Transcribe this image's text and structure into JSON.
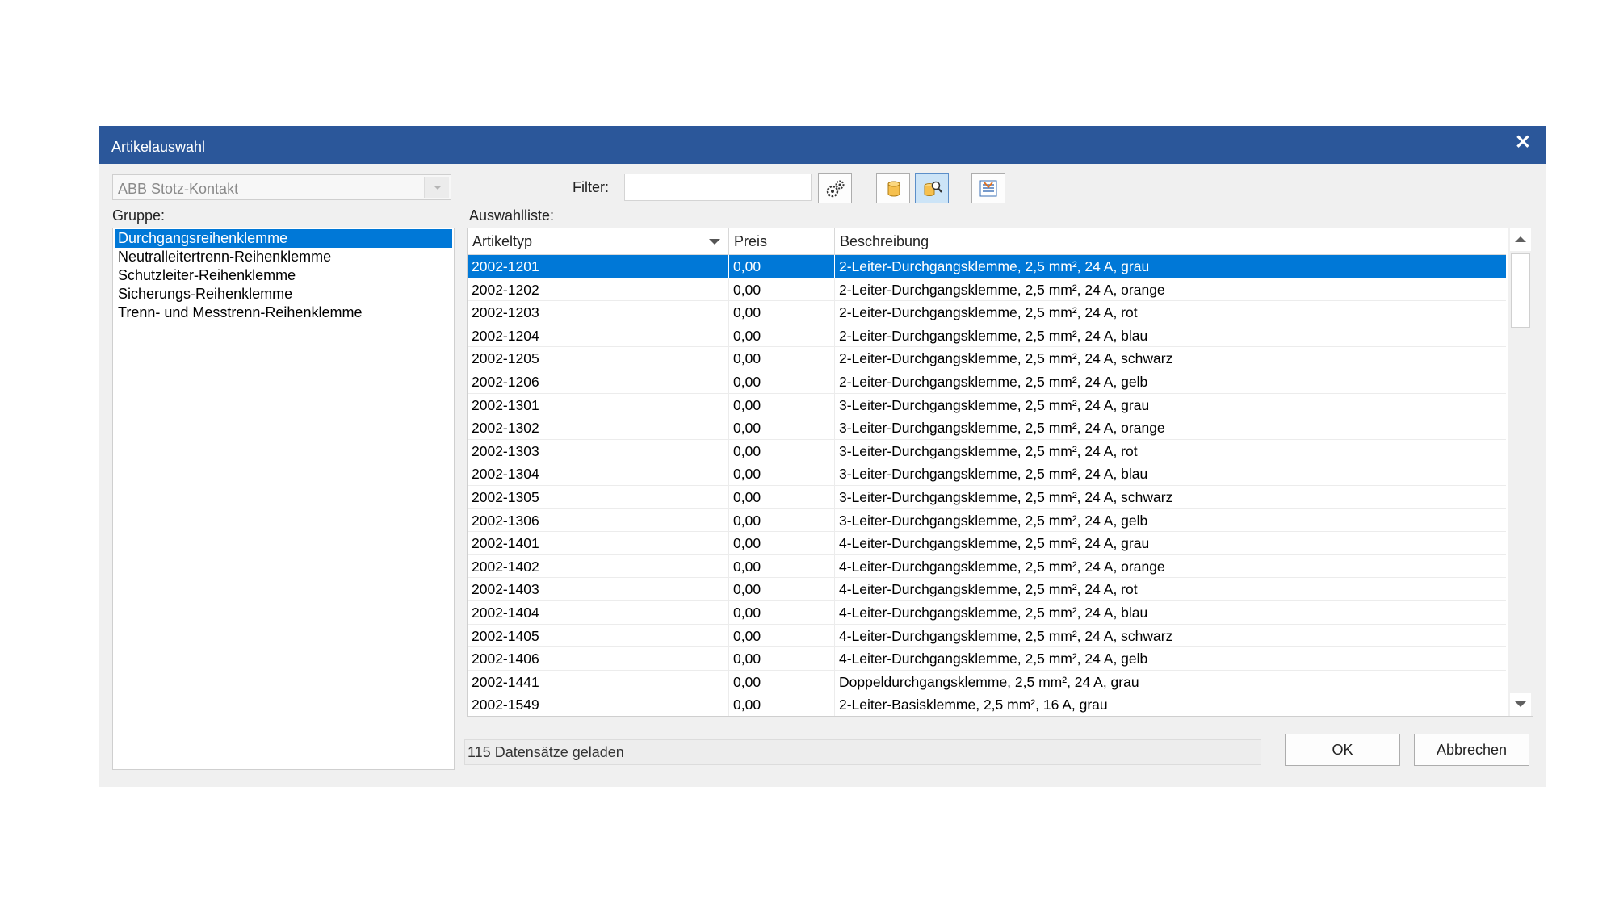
{
  "dialog": {
    "title": "Artikelauswahl"
  },
  "manufacturer": {
    "selected": "ABB Stotz-Kontakt"
  },
  "labels": {
    "group": "Gruppe:",
    "filter": "Filter:",
    "list": "Auswahlliste:"
  },
  "groups": [
    "Durchgangsreihenklemme",
    "Neutralleitertrenn-Reihenklemme",
    "Schutzleiter-Reihenklemme",
    "Sicherungs-Reihenklemme",
    "Trenn- und Messtrenn-Reihenklemme"
  ],
  "selected_group_index": 0,
  "filter": {
    "value": "",
    "placeholder": ""
  },
  "toolbar": {
    "filter_settings_icon": "gears-icon",
    "database_icon": "database-icon",
    "database_search_icon": "database-search-icon",
    "export_icon": "list-export-icon"
  },
  "table": {
    "columns": [
      "Artikeltyp",
      "Preis",
      "Beschreibung"
    ],
    "selected_row_index": 0,
    "rows": [
      [
        "2002-1201",
        "0,00",
        "2-Leiter-Durchgangsklemme, 2,5 mm², 24 A, grau"
      ],
      [
        "2002-1202",
        "0,00",
        "2-Leiter-Durchgangsklemme, 2,5 mm², 24 A, orange"
      ],
      [
        "2002-1203",
        "0,00",
        "2-Leiter-Durchgangsklemme, 2,5 mm², 24 A, rot"
      ],
      [
        "2002-1204",
        "0,00",
        "2-Leiter-Durchgangsklemme, 2,5 mm², 24 A, blau"
      ],
      [
        "2002-1205",
        "0,00",
        "2-Leiter-Durchgangsklemme, 2,5 mm², 24 A, schwarz"
      ],
      [
        "2002-1206",
        "0,00",
        "2-Leiter-Durchgangsklemme, 2,5 mm², 24 A, gelb"
      ],
      [
        "2002-1301",
        "0,00",
        "3-Leiter-Durchgangsklemme, 2,5 mm², 24 A, grau"
      ],
      [
        "2002-1302",
        "0,00",
        "3-Leiter-Durchgangsklemme, 2,5 mm², 24 A, orange"
      ],
      [
        "2002-1303",
        "0,00",
        "3-Leiter-Durchgangsklemme, 2,5 mm², 24 A, rot"
      ],
      [
        "2002-1304",
        "0,00",
        "3-Leiter-Durchgangsklemme, 2,5 mm², 24 A, blau"
      ],
      [
        "2002-1305",
        "0,00",
        "3-Leiter-Durchgangsklemme, 2,5 mm², 24 A, schwarz"
      ],
      [
        "2002-1306",
        "0,00",
        "3-Leiter-Durchgangsklemme, 2,5 mm², 24 A, gelb"
      ],
      [
        "2002-1401",
        "0,00",
        "4-Leiter-Durchgangsklemme, 2,5 mm², 24 A, grau"
      ],
      [
        "2002-1402",
        "0,00",
        "4-Leiter-Durchgangsklemme, 2,5 mm², 24 A, orange"
      ],
      [
        "2002-1403",
        "0,00",
        "4-Leiter-Durchgangsklemme, 2,5 mm², 24 A, rot"
      ],
      [
        "2002-1404",
        "0,00",
        "4-Leiter-Durchgangsklemme, 2,5 mm², 24 A, blau"
      ],
      [
        "2002-1405",
        "0,00",
        "4-Leiter-Durchgangsklemme, 2,5 mm², 24 A, schwarz"
      ],
      [
        "2002-1406",
        "0,00",
        "4-Leiter-Durchgangsklemme, 2,5 mm², 24 A, gelb"
      ],
      [
        "2002-1441",
        "0,00",
        "Doppeldurchgangsklemme, 2,5 mm², 24 A, grau"
      ],
      [
        "2002-1549",
        "0,00",
        "2-Leiter-Basisklemme, 2,5 mm², 16 A, grau"
      ]
    ]
  },
  "status": "115 Datensätze geladen",
  "buttons": {
    "ok": "OK",
    "cancel": "Abbrechen"
  },
  "colors": {
    "titlebar": "#2b579a",
    "selection": "#0078d7",
    "dialog_bg": "#f0f0f0"
  }
}
